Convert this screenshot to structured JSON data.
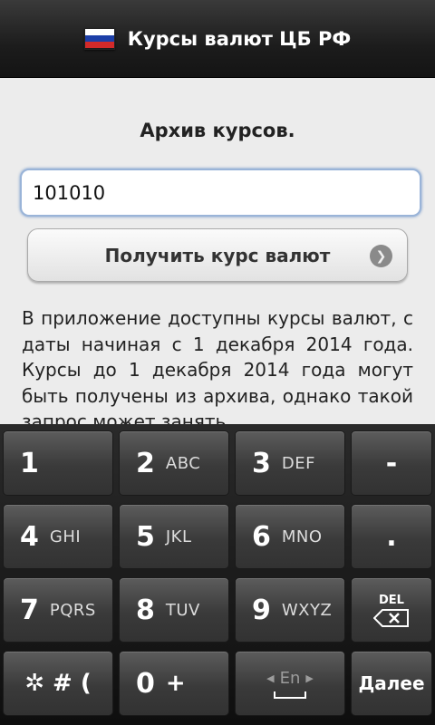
{
  "app": {
    "title": "Курсы валют ЦБ РФ",
    "flag_colors": [
      "#ffffff",
      "#1c3fa8",
      "#d22a2a"
    ]
  },
  "archive": {
    "heading": "Архив курсов.",
    "input_value": "101010",
    "submit_label": "Получить курс валют",
    "info_text": "В приложение доступны курсы валют, с даты начиная с 1 декабря 2014 года. Курсы до 1 декабря 2014 года могут быть получены из архива, однако такой запрос может занять"
  },
  "keyboard": {
    "rows": [
      [
        {
          "main": "1",
          "sub": ""
        },
        {
          "main": "2",
          "sub": "ABC"
        },
        {
          "main": "3",
          "sub": "DEF"
        },
        {
          "main": "-",
          "sub": ""
        }
      ],
      [
        {
          "main": "4",
          "sub": "GHI"
        },
        {
          "main": "5",
          "sub": "JKL"
        },
        {
          "main": "6",
          "sub": "MNO"
        },
        {
          "main": ".",
          "sub": ""
        }
      ],
      [
        {
          "main": "7",
          "sub": "PQRS"
        },
        {
          "main": "8",
          "sub": "TUV"
        },
        {
          "main": "9",
          "sub": "WXYZ"
        }
      ],
      [
        {
          "main": "0",
          "sub": "+"
        }
      ]
    ],
    "symbols_label": "✲ # (",
    "del_label": "DEL",
    "lang_label": "En",
    "done_label": "Далее"
  }
}
